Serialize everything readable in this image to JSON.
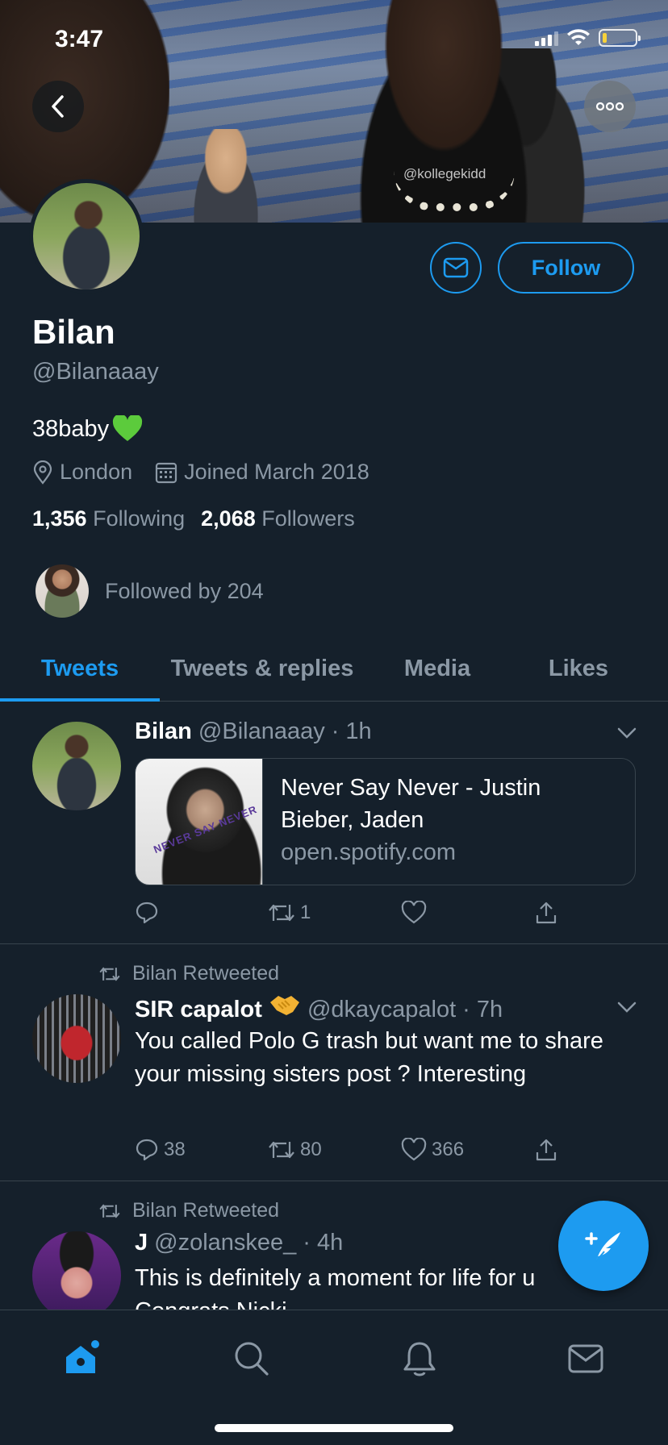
{
  "status_bar": {
    "time": "3:47"
  },
  "banner": {
    "watermark": "@kollegekidd"
  },
  "profile": {
    "name": "Bilan",
    "handle": "@Bilanaaay",
    "bio": "38baby",
    "location": "London",
    "joined": "Joined March 2018",
    "following_count": "1,356",
    "following_label": "Following",
    "followers_count": "2,068",
    "followers_label": "Followers",
    "followed_by": "Followed by 204",
    "follow_label": "Follow"
  },
  "tabs": [
    {
      "label": "Tweets",
      "active": true
    },
    {
      "label": "Tweets & replies",
      "active": false
    },
    {
      "label": "Media",
      "active": false
    },
    {
      "label": "Likes",
      "active": false
    }
  ],
  "tweets": [
    {
      "name": "Bilan",
      "handle": "@Bilanaaay",
      "time": "· 1h",
      "card": {
        "title": "Never Say Never - Justin Bieber, Jaden",
        "domain": "open.spotify.com",
        "album_text": "NEVER SAY NEVER"
      },
      "replies": "",
      "retweets": "1",
      "likes": ""
    },
    {
      "retweeted_by": "Bilan Retweeted",
      "name": "SIR capalot",
      "handle": "@dkaycapalot",
      "time": "· 7h",
      "text": "You called Polo G trash but want me to share your missing sisters post ? Interesting",
      "replies": "38",
      "retweets": "80",
      "likes": "366"
    },
    {
      "retweeted_by": "Bilan Retweeted",
      "name": "J",
      "handle": "@zolanskee_",
      "time": "· 4h",
      "text": "This is definitely a moment for life for u Congrats Nicki"
    }
  ],
  "colors": {
    "background": "#15202b",
    "accent": "#1d9bf0",
    "secondary_text": "#8b98a5",
    "divider": "#38444d"
  },
  "icons": [
    "back-arrow-icon",
    "more-icon",
    "mail-icon",
    "location-pin-icon",
    "calendar-icon",
    "reply-icon",
    "retweet-icon",
    "like-icon",
    "share-icon",
    "chevron-down-icon",
    "compose-icon",
    "home-icon",
    "search-icon",
    "notifications-icon",
    "messages-icon"
  ]
}
